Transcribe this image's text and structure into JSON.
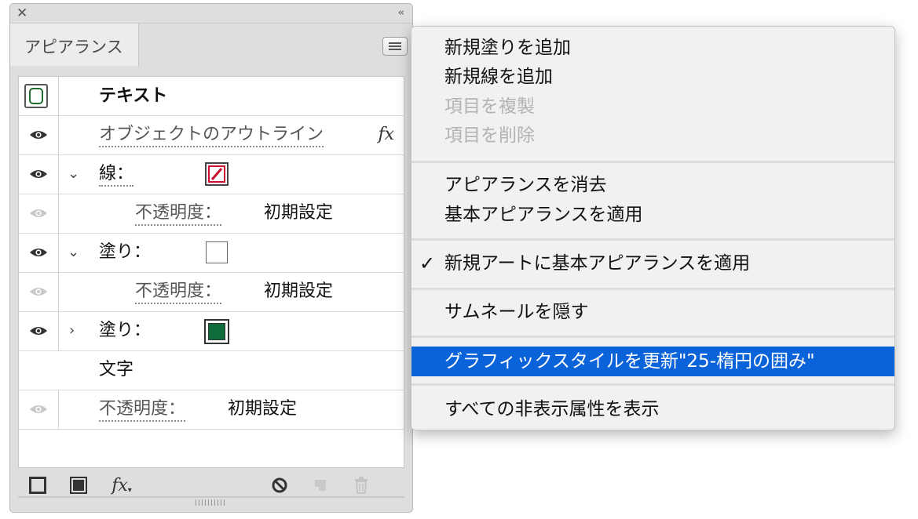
{
  "panel": {
    "tab_label": "アピアランス",
    "rows": {
      "object": {
        "label": "テキスト"
      },
      "effect": {
        "label": "オブジェクトのアウトライン",
        "fx": "fx"
      },
      "stroke": {
        "label": "線："
      },
      "stroke_opacity": {
        "label": "不透明度：",
        "value": "初期設定"
      },
      "fill1": {
        "label": "塗り："
      },
      "fill1_opacity": {
        "label": "不透明度：",
        "value": "初期設定"
      },
      "fill2": {
        "label": "塗り："
      },
      "characters": {
        "label": "文字"
      },
      "opacity": {
        "label": "不透明度：",
        "value": "初期設定"
      }
    },
    "colors": {
      "fill_green": "#0f6b3a",
      "stroke_red": "#c8102e",
      "thumb_green": "#1f6b2e"
    },
    "bottom_icons": [
      "add-stroke-icon",
      "add-fill-icon",
      "add-effect-icon",
      "clear-appearance-icon",
      "duplicate-item-icon",
      "delete-item-icon"
    ],
    "fx_button": "fx"
  },
  "menu": {
    "items": [
      {
        "label": "新規塗りを追加",
        "state": "enabled"
      },
      {
        "label": "新規線を追加",
        "state": "enabled"
      },
      {
        "label": "項目を複製",
        "state": "disabled"
      },
      {
        "label": "項目を削除",
        "state": "disabled"
      },
      {
        "label": "アピアランスを消去",
        "state": "enabled"
      },
      {
        "label": "基本アピアランスを適用",
        "state": "enabled"
      },
      {
        "label": "新規アートに基本アピアランスを適用",
        "state": "checked",
        "check": "✓"
      },
      {
        "label": "サムネールを隠す",
        "state": "enabled"
      },
      {
        "label": "グラフィックスタイルを更新\"25-楕円の囲み\"",
        "state": "highlighted"
      },
      {
        "label": "すべての非表示属性を表示",
        "state": "enabled"
      }
    ],
    "highlight_color": "#0a63d9"
  }
}
